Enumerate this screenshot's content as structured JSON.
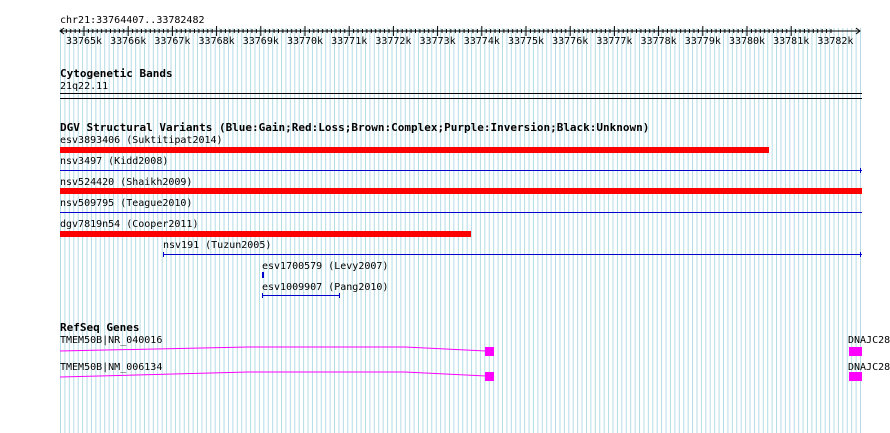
{
  "region_label": "chr21:33764407..33782482",
  "ruler": {
    "ticks": [
      "33765k",
      "33766k",
      "33767k",
      "33768k",
      "33769k",
      "33770k",
      "33771k",
      "33772k",
      "33773k",
      "33774k",
      "33775k",
      "33776k",
      "33777k",
      "33778k",
      "33779k",
      "33780k",
      "33781k",
      "33782k"
    ]
  },
  "tracks": {
    "cytoband": {
      "title": "Cytogenetic Bands",
      "band": "21q22.11"
    },
    "dgv": {
      "title": "DGV Structural Variants (Blue:Gain;Red:Loss;Brown:Complex;Purple:Inversion;Black:Unknown)",
      "features": [
        {
          "label": "esv3893406 (Suktitipat2014)",
          "color": "#ff0000"
        },
        {
          "label": "nsv3497 (Kidd2008)",
          "color": "#0000cc"
        },
        {
          "label": "nsv524420 (Shaikh2009)",
          "color": "#ff0000"
        },
        {
          "label": "nsv509795 (Teague2010)",
          "color": "#0000cc"
        },
        {
          "label": "dgv7819n54 (Cooper2011)",
          "color": "#ff0000"
        },
        {
          "label": "nsv191 (Tuzun2005)",
          "color": "#0000cc"
        },
        {
          "label": "esv1700579 (Levy2007)",
          "color": "#0000cc"
        },
        {
          "label": "esv1009907 (Pang2010)",
          "color": "#0000cc"
        }
      ]
    },
    "refseq": {
      "title": "RefSeq Genes",
      "genes": [
        {
          "label": "TMEM50B|NR_040016",
          "right_label": "DNAJC28",
          "color": "#ff00ff"
        },
        {
          "label": "TMEM50B|NM_006134",
          "right_label": "DNAJC28",
          "color": "#ff00ff"
        }
      ]
    }
  },
  "colors": {
    "grid_line": "#b4dce6",
    "loss": "#ff0000",
    "gain": "#0000cc",
    "gene": "#ff00ff"
  }
}
